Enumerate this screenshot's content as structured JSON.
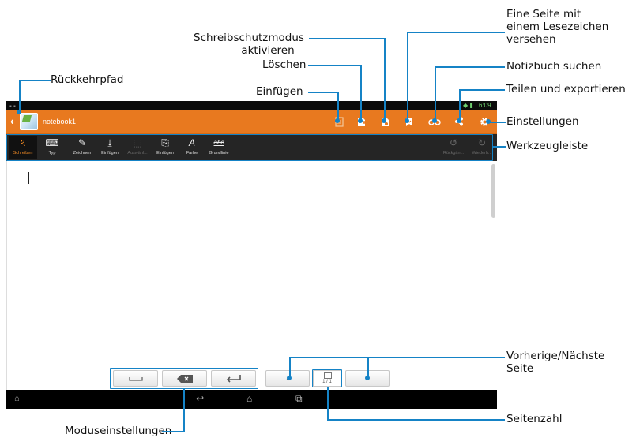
{
  "callouts": {
    "rueckkehrpfad": "Rückkehrpfad",
    "schreibschutz_line1": "Schreibschutzmodus",
    "schreibschutz_line2": "aktivieren",
    "loeschen": "Löschen",
    "einfuegen": "Einfügen",
    "lesezeichen_line1": "Eine Seite mit",
    "lesezeichen_line2": "einem Lesezeichen",
    "lesezeichen_line3": "versehen",
    "notizbuch_suchen": "Notizbuch suchen",
    "teilen": "Teilen und exportieren",
    "einstellungen": "Einstellungen",
    "werkzeugleiste": "Werkzeugleiste",
    "vorherige_line1": "Vorherige/Nächste",
    "vorherige_line2": "Seite",
    "seitenzahl": "Seitenzahl",
    "moduseinstellungen": "Moduseinstellungen"
  },
  "statusbar": {
    "time": "6:09"
  },
  "titlebar": {
    "back_glyph": "‹",
    "notebook_title": "notebook1",
    "icons": [
      "insert-page-icon",
      "delete-page-icon",
      "read-only-icon",
      "bookmark-icon",
      "search-icon",
      "share-icon",
      "settings-icon"
    ]
  },
  "toolbar": {
    "tools": [
      {
        "label": "Schreiben",
        "glyph": "ঽ",
        "state": "active"
      },
      {
        "label": "Typ",
        "glyph": "⌨",
        "state": "normal"
      },
      {
        "label": "Zeichnen",
        "glyph": "✎",
        "state": "normal"
      },
      {
        "label": "Einfügen",
        "glyph": "⤓",
        "state": "normal"
      },
      {
        "label": "Auswähl...",
        "glyph": "⬚",
        "state": "disabled"
      },
      {
        "label": "Einfügen",
        "glyph": "⎘",
        "state": "normal"
      },
      {
        "label": "Farbe",
        "glyph": "A",
        "state": "normal"
      },
      {
        "label": "Grundlinie",
        "glyph": "abc",
        "state": "normal"
      }
    ],
    "undo_label": "Rückgän...",
    "redo_label": "Wiederh..."
  },
  "pager": {
    "page_indicator": "1 / 1"
  },
  "colors": {
    "accent": "#e8791f",
    "callout_line": "#1583c6",
    "toolbar": "#252525"
  }
}
